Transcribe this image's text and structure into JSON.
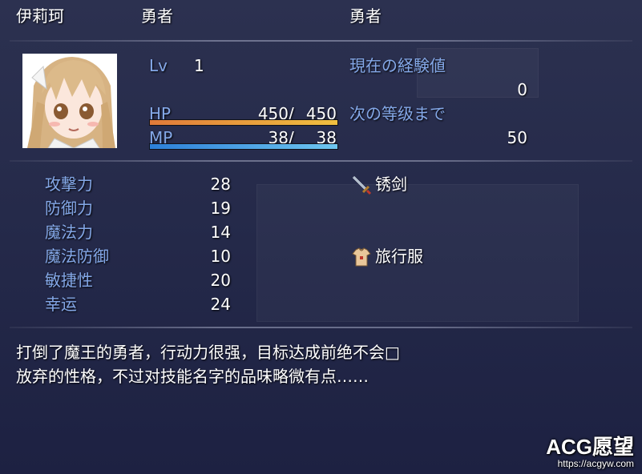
{
  "header": {
    "name": "伊莉珂",
    "class": "勇者",
    "nickname": "勇者"
  },
  "status": {
    "level_label": "Lv",
    "level": "1",
    "hp_label": "HP",
    "hp_current": "450",
    "hp_separator": "/",
    "hp_max": "450",
    "hp_ratio": 1.0,
    "mp_label": "MP",
    "mp_current": "38",
    "mp_separator": "/",
    "mp_max": "38",
    "mp_ratio": 1.0
  },
  "experience": {
    "current_label": "現在の経験値",
    "current_value": "0",
    "next_label": "次の等级まで",
    "next_value": "50"
  },
  "params": [
    {
      "label": "攻撃力",
      "value": "28"
    },
    {
      "label": "防御力",
      "value": "19"
    },
    {
      "label": "魔法力",
      "value": "14"
    },
    {
      "label": "魔法防御",
      "value": "10"
    },
    {
      "label": "敏捷性",
      "value": "20"
    },
    {
      "label": "幸运",
      "value": "24"
    }
  ],
  "equipment": [
    {
      "name": "锈剑",
      "icon": "sword-icon"
    },
    {
      "name": "旅行服",
      "icon": "armor-icon"
    }
  ],
  "profile": {
    "line1": "打倒了魔王的勇者，行动力很强，目标达成前绝不会□",
    "line2": "放弃的性格，不过对技能名字的品味略微有点……"
  },
  "watermark": {
    "title": "ACG愿望",
    "url": "https://acgyw.com"
  },
  "colors": {
    "system_text": "#84a8e8",
    "hp_gauge": "#f0c040",
    "mp_gauge": "#6ec6f0"
  }
}
